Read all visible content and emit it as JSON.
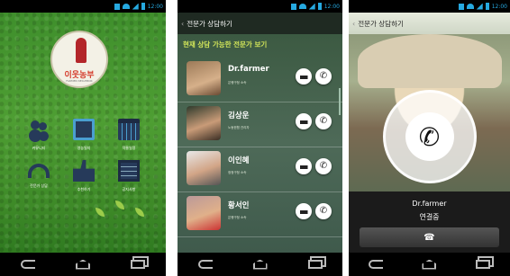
{
  "status_bar": {
    "time": "12:00"
  },
  "phone1": {
    "logo_text": "이웃농부",
    "logo_sub": "FARMER NEIGHBOR",
    "menu": [
      {
        "label": "커뮤니티",
        "icon": "people-icon"
      },
      {
        "label": "영농일지",
        "icon": "document-icon"
      },
      {
        "label": "작물일정",
        "icon": "calendar-icon"
      },
      {
        "label": "전문가 상담",
        "icon": "headset-icon"
      },
      {
        "label": "추천하기",
        "icon": "thumbs-up-icon"
      },
      {
        "label": "공지사항",
        "icon": "clipboard-icon"
      }
    ]
  },
  "phone2": {
    "title": "전문가 상담하기",
    "heading": "현재 상담 가능한 전문가 보기",
    "experts": [
      {
        "name": "Dr.farmer",
        "role": "은행구청 소속"
      },
      {
        "name": "김상운",
        "role": "노동한협 관리자"
      },
      {
        "name": "이인혜",
        "role": "정청구청 소속"
      },
      {
        "name": "황서인",
        "role": "은행구청 소속"
      }
    ]
  },
  "phone3": {
    "title": "전문가 상담하기",
    "caller": "Dr.farmer",
    "status": "연결중"
  },
  "colors": {
    "heading_accent": "#d5e85a",
    "status_blue": "#26a9e0"
  }
}
